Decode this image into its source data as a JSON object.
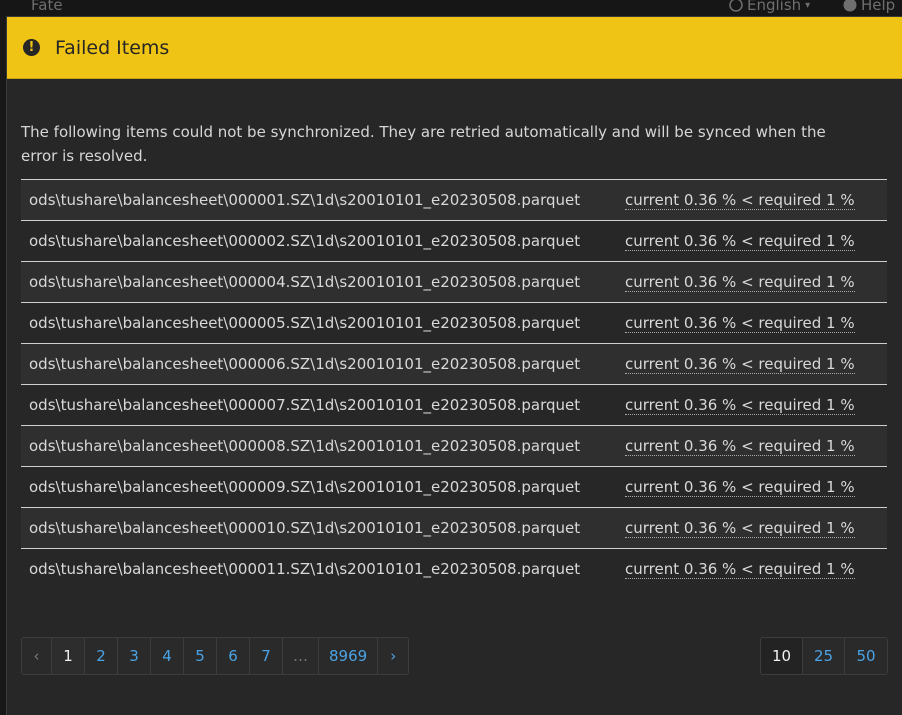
{
  "background": {
    "brand": "Fate",
    "language": "English",
    "help": "Help"
  },
  "modal": {
    "title": "Failed Items",
    "intro": "The following items could not be synchronized. They are retried automatically and will be synced when the error is resolved.",
    "items": [
      {
        "path": "ods\\tushare\\balancesheet\\000001.SZ\\1d\\s20010101_e20230508.parquet",
        "error": "current 0.36 % < required 1 %"
      },
      {
        "path": "ods\\tushare\\balancesheet\\000002.SZ\\1d\\s20010101_e20230508.parquet",
        "error": "current 0.36 % < required 1 %"
      },
      {
        "path": "ods\\tushare\\balancesheet\\000004.SZ\\1d\\s20010101_e20230508.parquet",
        "error": "current 0.36 % < required 1 %"
      },
      {
        "path": "ods\\tushare\\balancesheet\\000005.SZ\\1d\\s20010101_e20230508.parquet",
        "error": "current 0.36 % < required 1 %"
      },
      {
        "path": "ods\\tushare\\balancesheet\\000006.SZ\\1d\\s20010101_e20230508.parquet",
        "error": "current 0.36 % < required 1 %"
      },
      {
        "path": "ods\\tushare\\balancesheet\\000007.SZ\\1d\\s20010101_e20230508.parquet",
        "error": "current 0.36 % < required 1 %"
      },
      {
        "path": "ods\\tushare\\balancesheet\\000008.SZ\\1d\\s20010101_e20230508.parquet",
        "error": "current 0.36 % < required 1 %"
      },
      {
        "path": "ods\\tushare\\balancesheet\\000009.SZ\\1d\\s20010101_e20230508.parquet",
        "error": "current 0.36 % < required 1 %"
      },
      {
        "path": "ods\\tushare\\balancesheet\\000010.SZ\\1d\\s20010101_e20230508.parquet",
        "error": "current 0.36 % < required 1 %"
      },
      {
        "path": "ods\\tushare\\balancesheet\\000011.SZ\\1d\\s20010101_e20230508.parquet",
        "error": "current 0.36 % < required 1 %"
      }
    ],
    "pagination": {
      "prev": "‹",
      "pages": [
        "1",
        "2",
        "3",
        "4",
        "5",
        "6",
        "7"
      ],
      "ellipsis": "…",
      "last": "8969",
      "next": "›",
      "active_page": "1"
    },
    "page_sizes": {
      "options": [
        "10",
        "25",
        "50"
      ],
      "active": "10"
    }
  },
  "colors": {
    "header": "#f0c414",
    "link": "#4aa3e6",
    "background": "#272727"
  },
  "icons": {
    "header": "exclamation-circle-icon",
    "language": "globe-icon",
    "help": "question-circle-icon"
  }
}
